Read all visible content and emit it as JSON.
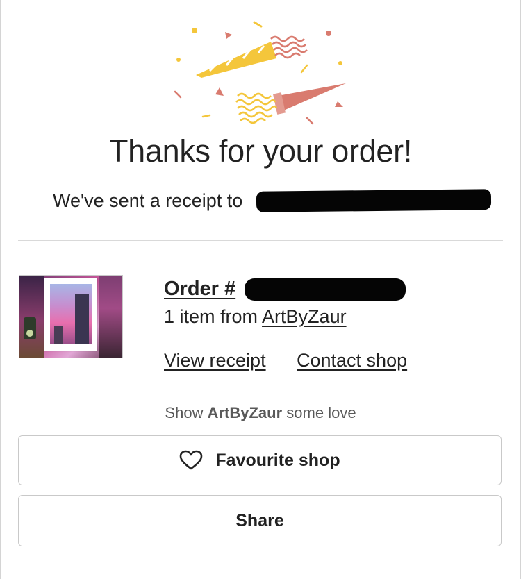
{
  "header": {
    "illustration_icon": "party-popper-confetti-icon",
    "title": "Thanks for your order!",
    "receipt_text": "We've sent a receipt to"
  },
  "order": {
    "title_prefix": "Order #",
    "item_count_text": "1 item from",
    "shop_name": "ArtByZaur",
    "view_receipt_label": "View receipt",
    "contact_shop_label": "Contact shop"
  },
  "love": {
    "prefix": "Show",
    "shop_name": "ArtByZaur",
    "suffix": "some love"
  },
  "actions": {
    "favourite_label": "Favourite shop",
    "favourite_icon": "heart-outline-icon",
    "share_label": "Share"
  },
  "colors": {
    "confetti_yellow": "#f4c63b",
    "confetti_coral": "#d97b6f",
    "text": "#222222",
    "muted_text": "#595959",
    "border": "#c9c9c9"
  }
}
